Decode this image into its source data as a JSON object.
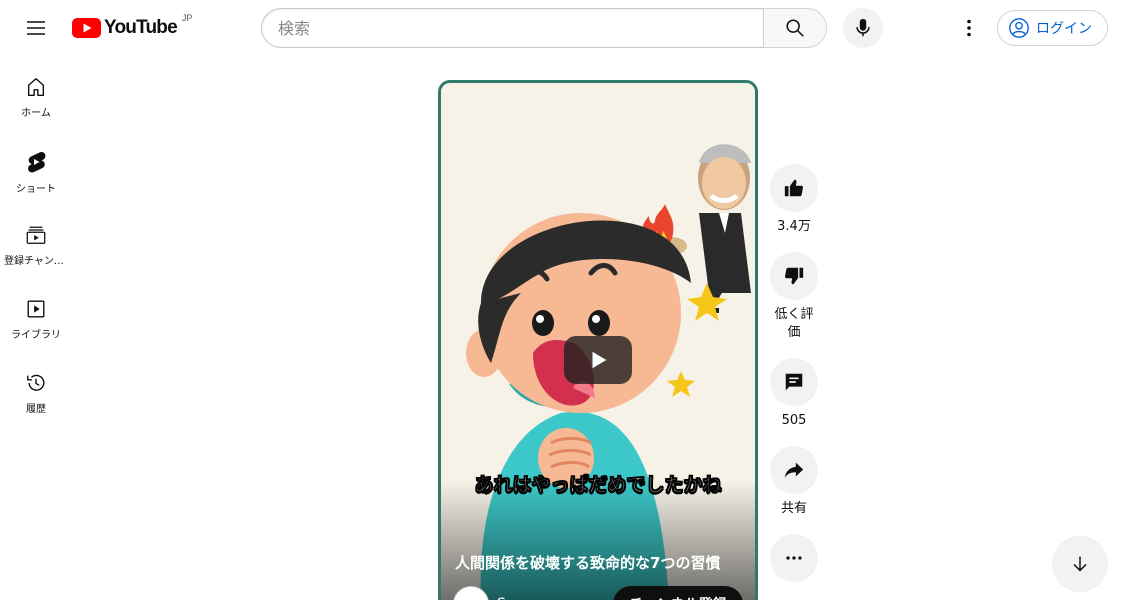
{
  "header": {
    "logo_text": "YouTube",
    "country_code": "JP",
    "search_placeholder": "検索",
    "login_label": "ログイン"
  },
  "sidebar": {
    "items": [
      {
        "label": "ホーム",
        "icon": "home-icon"
      },
      {
        "label": "ショート",
        "icon": "shorts-icon"
      },
      {
        "label": "登録チャンネル",
        "icon": "subscriptions-icon"
      },
      {
        "label": "ライブラリ",
        "icon": "library-icon"
      },
      {
        "label": "履歴",
        "icon": "history-icon"
      }
    ]
  },
  "video": {
    "caption": "あれはやっぱだめでしたかね",
    "title": "人間関係を破壊する致命的な7つの習慣",
    "channel_name": "S",
    "subscribe_label": "チャンネル登録"
  },
  "actions": {
    "like_count": "3.4万",
    "dislike_label": "低く評価",
    "comment_count": "505",
    "share_label": "共有"
  },
  "colors": {
    "brand_red": "#ff0000",
    "link_blue": "#065fd4",
    "video_border": "#2f7a6a"
  }
}
